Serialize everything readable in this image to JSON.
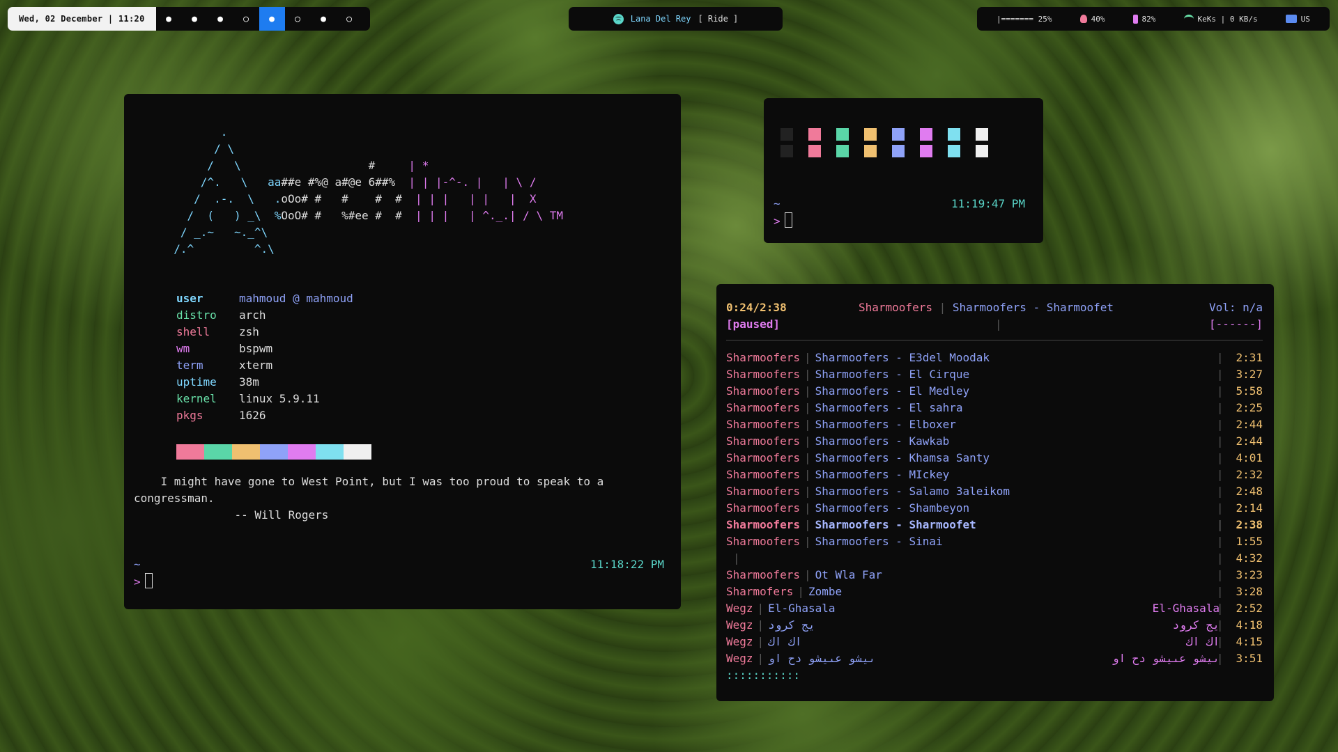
{
  "topbar": {
    "date": "Wed, 02 December | 11:20",
    "workspaces": [
      "●",
      "●",
      "●",
      "○",
      "●",
      "○",
      "●",
      "○"
    ],
    "active_workspace": 4,
    "now_playing": {
      "artist": "Lana Del Rey",
      "title": "[ Ride ]"
    },
    "status": {
      "volume": "|======= 25%",
      "brightness": "40%",
      "battery": "82%",
      "network": "KeKs | 0 KB/s",
      "keyboard": "US"
    }
  },
  "fetch_terminal": {
    "ascii_logo_lines": [
      "         .",
      "        / \\",
      "       /   \\                   #     | *",
      "      /^.   \\   aa##e #%@ a#@e 6##%  | | |-^-. |   | \\ /",
      "     /  .-.  \\   .oOo# #   #    #  #  | | |   | |   |  X",
      "    /  (   ) _\\  %OoO# #   %#ee #  #  | | |   | ^._.| / \\ TM",
      "   / _.~   ~._^\\",
      "  /.^         ^.\\"
    ],
    "info": [
      {
        "key": "user",
        "value": "mahmoud @ mahmoud",
        "color": "#7fd7ff"
      },
      {
        "key": "distro",
        "value": "arch",
        "color": "#68e0a8"
      },
      {
        "key": "shell",
        "value": "zsh",
        "color": "#f07a9a"
      },
      {
        "key": "wm",
        "value": "bspwm",
        "color": "#e07cf0"
      },
      {
        "key": "term",
        "value": "xterm",
        "color": "#8fa2f8"
      },
      {
        "key": "uptime",
        "value": "38m",
        "color": "#7fd7ff"
      },
      {
        "key": "kernel",
        "value": "linux 5.9.11",
        "color": "#68e0a8"
      },
      {
        "key": "pkgs",
        "value": "1626",
        "color": "#f07a9a"
      }
    ],
    "swatch_colors": [
      "#f07a9a",
      "#5ad6a8",
      "#f0c070",
      "#8fa2f8",
      "#e07cf0",
      "#7fe0f0",
      "#f0f0f0"
    ],
    "quote": "    I might have gone to West Point, but I was too proud to speak to a congressman.\n               -- Will Rogers",
    "tilde": "~",
    "prompt": ">",
    "clock": "11:18:22 PM"
  },
  "color_terminal": {
    "grid_colors": [
      "#222222",
      "#f07a9a",
      "#5ad6a8",
      "#f0c070",
      "#8fa2f8",
      "#e07cf0",
      "#7fe0f0",
      "#f0f0f0"
    ],
    "tilde": "~",
    "prompt": ">",
    "clock": "11:19:47 PM"
  },
  "player": {
    "elapsed": "0:24/2:38",
    "state": "[paused]",
    "artist": "Sharmoofers",
    "title": "Sharmoofers - Sharmoofet",
    "volume": "Vol: n/a",
    "bar": "[------]",
    "tracks": [
      {
        "artist": "Sharmoofers",
        "title": "Sharmoofers - E3del Moodak",
        "extra": "",
        "duration": "2:31"
      },
      {
        "artist": "Sharmoofers",
        "title": "Sharmoofers - El Cirque",
        "extra": "",
        "duration": "3:27"
      },
      {
        "artist": "Sharmoofers",
        "title": "Sharmoofers - El Medley",
        "extra": "",
        "duration": "5:58"
      },
      {
        "artist": "Sharmoofers",
        "title": "Sharmoofers - El sahra",
        "extra": "",
        "duration": "2:25"
      },
      {
        "artist": "Sharmoofers",
        "title": "Sharmoofers - Elboxer",
        "extra": "",
        "duration": "2:44"
      },
      {
        "artist": "Sharmoofers",
        "title": "Sharmoofers - Kawkab",
        "extra": "",
        "duration": "2:44"
      },
      {
        "artist": "Sharmoofers",
        "title": "Sharmoofers - Khamsa Santy",
        "extra": "",
        "duration": "4:01"
      },
      {
        "artist": "Sharmoofers",
        "title": "Sharmoofers - MIckey",
        "extra": "",
        "duration": "2:32"
      },
      {
        "artist": "Sharmoofers",
        "title": "Sharmoofers - Salamo 3aleikom",
        "extra": "",
        "duration": "2:48"
      },
      {
        "artist": "Sharmoofers",
        "title": "Sharmoofers - Shambeyon",
        "extra": "",
        "duration": "2:14"
      },
      {
        "artist": "Sharmoofers",
        "title": "Sharmoofers - Sharmoofet",
        "extra": "",
        "duration": "2:38",
        "current": true
      },
      {
        "artist": "Sharmoofers",
        "title": "Sharmoofers - Sinai",
        "extra": "",
        "duration": "1:55"
      },
      {
        "artist": "",
        "title": "",
        "extra": "",
        "duration": "4:32"
      },
      {
        "artist": "Sharmoofers",
        "title": "Ot Wla Far",
        "extra": "",
        "duration": "3:23"
      },
      {
        "artist": "Sharmofers",
        "title": "Zombe",
        "extra": "",
        "duration": "3:28"
      },
      {
        "artist": "Wegz",
        "title": "El-Ghasala",
        "extra": "El-Ghasala",
        "duration": "2:52"
      },
      {
        "artist": "Wegz",
        "title": "يج كرود",
        "extra": "يج كرود",
        "duration": "4:18"
      },
      {
        "artist": "Wegz",
        "title": "اك اك",
        "extra": "اك اك",
        "duration": "4:15"
      },
      {
        "artist": "Wegz",
        "title": "ىيشو عىيشو دح او",
        "extra": "ىيشو عىيشو دح او",
        "duration": "3:51"
      }
    ],
    "footer": ":::::::::::"
  }
}
